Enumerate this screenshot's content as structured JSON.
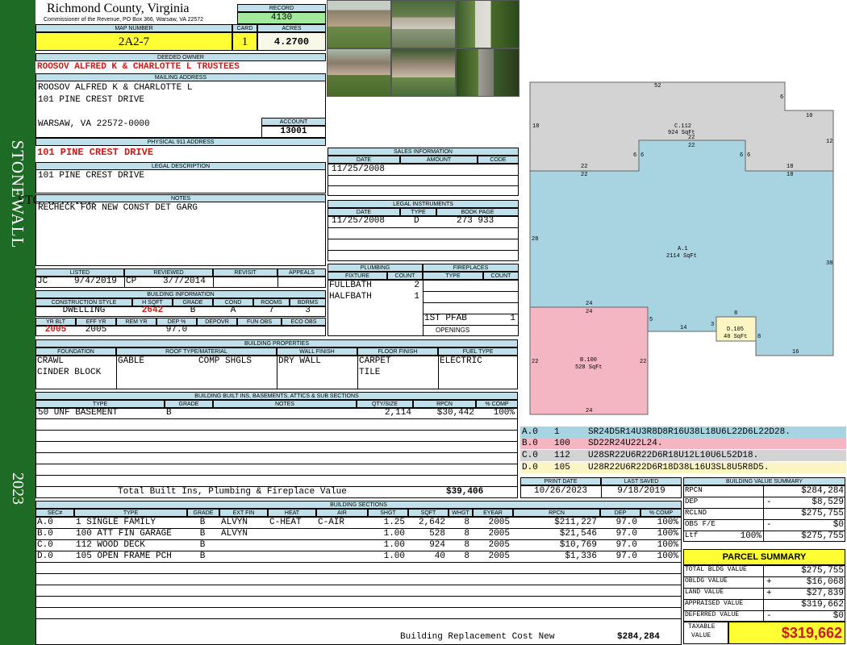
{
  "sidebar": {
    "district": "STONEWALL",
    "year": "2023"
  },
  "header": {
    "county": "Richmond County, Virginia",
    "office": "Commissioner of the Revenue, PO Box 366, Warsaw, VA 22572",
    "record_label": "RECORD",
    "record": "4130",
    "map_label": "MAP NUMBER",
    "map": "2A2-7",
    "card_label": "CARD",
    "card": "1",
    "acres_label": "ACRES",
    "acres": "4.2700"
  },
  "owner": {
    "label": "DEEDED OWNER",
    "name": "ROOSOV ALFRED K & CHARLOTTE L TRUSTEES"
  },
  "mailing": {
    "label": "MAILING ADDRESS",
    "line1": "ROOSOV ALFRED K & CHARLOTTE L",
    "line2": "101 PINE CREST DRIVE",
    "line3": "WARSAW, VA 22572-0000"
  },
  "account": {
    "label": "ACCOUNT",
    "value": "13001"
  },
  "physical": {
    "label": "PHYSICAL 911 ADDRESS",
    "value": "101 PINE CREST DRIVE"
  },
  "legal": {
    "label": "LEGAL DESCRIPTION",
    "value": "101 PINE CREST DRIVE"
  },
  "notes": {
    "label": "NOTES",
    "value": "RECHECK FOR NEW CONST DET GARG"
  },
  "listing": {
    "h_listed": "LISTED",
    "h_reviewed": "REVIEWED",
    "h_revisit": "REVISIT",
    "h_appeals": "APPEALS",
    "listed_by": "JC",
    "listed_date": "9/4/2019",
    "reviewed_by": "CP",
    "reviewed_date": "3/7/2014"
  },
  "building_info": {
    "label": "BUILDING INFORMATION",
    "h_style": "CONSTRUCTION STYLE",
    "h_hsqft": "H SQFT",
    "h_grade": "GRADE",
    "h_cond": "COND",
    "h_rooms": "ROOMS",
    "h_bdrms": "BDRMS",
    "style": "DWELLING",
    "hsqft": "2642",
    "grade": "B",
    "cond": "A",
    "rooms": "7",
    "bdrms": "3",
    "h_yrblt": "YR BLT",
    "h_effyr": "EFF YR",
    "h_remyr": "REM YR",
    "h_dep": "DEP %",
    "h_depovr": "DEPOVR",
    "h_funobs": "FUN OBS",
    "h_ecoobs": "ECO OBS",
    "yrblt": "2005",
    "effyr": "2005",
    "dep": "97.0"
  },
  "sales": {
    "label": "SALES INFORMATION",
    "h_date": "DATE",
    "h_amount": "AMOUNT",
    "h_code": "CODE",
    "date": "11/25/2008"
  },
  "legal_instr": {
    "label": "LEGAL INSTRUMENTS",
    "h_date": "DATE",
    "h_type": "TYPE",
    "h_book": "BOOK PAGE",
    "date": "11/25/2008",
    "type": "D",
    "book": "273 933"
  },
  "plumbing": {
    "label": "PLUMBING",
    "h_fixture": "FIXTURE",
    "h_count": "COUNT",
    "fix1": "FULLBATH",
    "cnt1": "2",
    "fix2": "HALFBATH",
    "cnt2": "1"
  },
  "fireplaces": {
    "label": "FIREPLACES",
    "h_type": "TYPE",
    "h_count": "COUNT",
    "type1": "1ST PFAB",
    "cnt1": "1",
    "openings": "OPENINGS"
  },
  "properties": {
    "label": "BUILDING PROPERTIES",
    "h_foundation": "FOUNDATION",
    "h_roof": "ROOF TYPE/MATERIAL",
    "h_wall": "WALL FINISH",
    "h_floor": "FLOOR FINISH",
    "h_fuel": "FUEL TYPE",
    "foundation1": "CRAWL",
    "foundation2": "CINDER BLOCK",
    "roof1": "GABLE",
    "roof2": "COMP SHGLS",
    "wall": "DRY WALL",
    "floor1": "CARPET",
    "floor2": "TILE",
    "fuel": "ELECTRIC"
  },
  "builtins": {
    "label": "BUILDING BUILT INS, BASEMENTS, ATTICS & SUB SECTIONS",
    "h_type": "TYPE",
    "h_grade": "GRADE",
    "h_notes": "NOTES",
    "h_qty": "QTY/SIZE",
    "h_rpcn": "RPCN",
    "h_comp": "% COMP",
    "r_type": "50 UNF BASEMENT",
    "r_grade": "B",
    "r_qty": "2,114",
    "r_rpcn": "$30,442",
    "r_comp": "100%",
    "total_label": "Total Built Ins, Plumbing & Fireplace Value",
    "total": "$39,406"
  },
  "sections": {
    "label": "BUILDING SECTIONS",
    "headers": [
      "SEC#",
      "TYPE",
      "GRADE",
      "EXT FIN",
      "HEAT",
      "AIR",
      "SHGT",
      "SQFT",
      "WHGT",
      "EYEAR",
      "RPCN",
      "DEP",
      "% COMP"
    ],
    "rows": [
      [
        "A.0",
        "1 SINGLE FAMILY",
        "B",
        "ALVYN",
        "C-HEAT",
        "C-AIR",
        "1.25",
        "2,642",
        "8",
        "2005",
        "$211,227",
        "97.0",
        "100%"
      ],
      [
        "B.0",
        "100 ATT FIN GARAGE",
        "B",
        "ALVYN",
        "",
        "",
        "1.00",
        "528",
        "8",
        "2005",
        "$21,546",
        "97.0",
        "100%"
      ],
      [
        "C.0",
        "112 WOOD DECK",
        "B",
        "",
        "",
        "",
        "1.00",
        "924",
        "8",
        "2005",
        "$10,769",
        "97.0",
        "100%"
      ],
      [
        "D.0",
        "105 OPEN FRAME PCH",
        "B",
        "",
        "",
        "",
        "1.00",
        "40",
        "8",
        "2005",
        "$1,336",
        "97.0",
        "100%"
      ]
    ],
    "replacement_label": "Building Replacement Cost New",
    "replacement": "$284,284"
  },
  "sketch": {
    "dims": {
      "d52": "52",
      "d6a": "6",
      "d10": "10",
      "d12": "12",
      "d18a": "18",
      "d6b": "6",
      "d6c": "6",
      "d6d": "6",
      "d6e": "6",
      "d22a": "22",
      "d22b": "22",
      "d22c": "22",
      "d22d": "22",
      "d18b": "18",
      "d18c": "18",
      "d28": "28",
      "d38": "38",
      "d24a": "24",
      "d24b": "24",
      "d24c": "24",
      "d5": "5",
      "d14": "14",
      "d3": "3",
      "d8a": "8",
      "d8b": "8",
      "d16": "16",
      "d22e": "22",
      "d22f": "22"
    },
    "c_name": "C.112",
    "c_area": "924 SqFt",
    "a_name": "A.1",
    "a_area": "2114 SqFt",
    "b_name": "B.100",
    "b_area": "528 SqFt",
    "d_name": "D.105",
    "d_area": "40 SqFt",
    "color_a": "#a8d4e2",
    "color_b": "#f4b6c2",
    "color_c": "#d3d3d3",
    "color_d": "#fbf5c4"
  },
  "vectors": [
    {
      "id": "A.0",
      "code": "1",
      "path": "SR24D5R14U3R8D8R16U38L18U6L22D6L22D28.",
      "color": "#a8d4e2"
    },
    {
      "id": "B.0",
      "code": "100",
      "path": "SD22R24U22L24.",
      "color": "#f4b6c2"
    },
    {
      "id": "C.0",
      "code": "112",
      "path": "U28SR22U6R22D6R18U12L10U6L52D18.",
      "color": "#d3d3d3"
    },
    {
      "id": "D.0",
      "code": "105",
      "path": "U28R22U6R22D6R18D38L16U3SL8U5R8D5.",
      "color": "#fbf5c4"
    }
  ],
  "dates": {
    "print_label": "PRINT DATE",
    "print": "10/26/2023",
    "saved_label": "LAST SAVED",
    "saved": "9/18/2019"
  },
  "value_summary": {
    "label": "BUILDING VALUE SUMMARY",
    "rpcn_label": "RPCN",
    "rpcn": "$284,284",
    "dep_label": "DEP",
    "dep_sign": "-",
    "dep": "$8,529",
    "rclnd_label": "RCLND",
    "rclnd": "$275,755",
    "obs_label": "OBS F/E",
    "obs_sign": "-",
    "obs": "$0",
    "ltf_label": "Ltf",
    "ltf_pct": "100%",
    "ltf": "$275,755"
  },
  "parcel": {
    "label": "PARCEL SUMMARY",
    "bldg_label": "TOTAL BLDG VALUE",
    "bldg": "$275,755",
    "obldg_label": "OBLDG VALUE",
    "obldg_sign": "+",
    "obldg": "$16,068",
    "land_label": "LAND VALUE",
    "land_sign": "+",
    "land": "$27,839",
    "appraised_label": "APPRAISED VALUE",
    "appraised": "$319,662",
    "deferred_label": "DEFERRED VALUE",
    "deferred_sign": "-",
    "deferred": "$0",
    "taxable_label1": "TAXABLE",
    "taxable_label2": "VALUE",
    "taxable": "$319,662"
  }
}
